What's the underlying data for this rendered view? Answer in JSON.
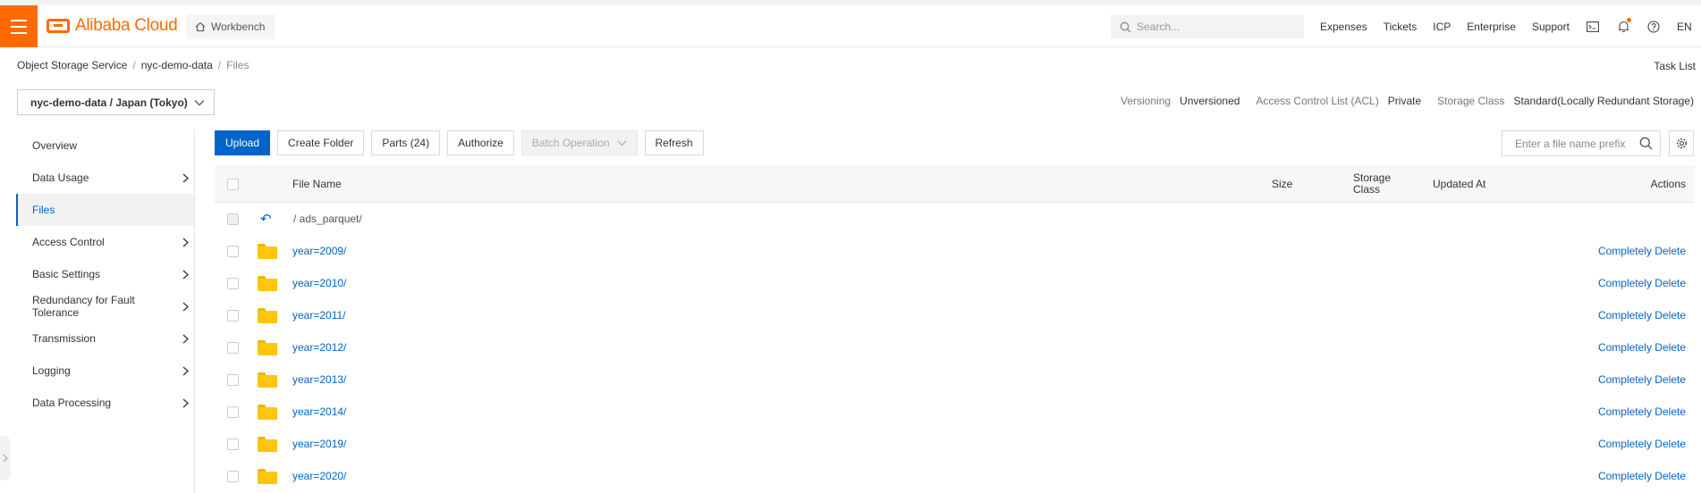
{
  "header": {
    "logo_text": "Alibaba Cloud",
    "workbench_label": "Workbench",
    "search_placeholder": "Search...",
    "links": [
      "Expenses",
      "Tickets",
      "ICP",
      "Enterprise",
      "Support"
    ],
    "lang": "EN",
    "accent": "#ff6a00"
  },
  "breadcrumb": [
    "Object Storage Service",
    "nyc-demo-data",
    "Files"
  ],
  "task_list": "Task List",
  "bucket": {
    "selected": "nyc-demo-data / Japan (Tokyo)",
    "meta": [
      {
        "key": "Versioning",
        "value": "Unversioned"
      },
      {
        "key": "Access Control List (ACL)",
        "value": "Private"
      },
      {
        "key": "Storage Class",
        "value": "Standard(Locally Redundant Storage)"
      }
    ]
  },
  "sidebar": {
    "items": [
      {
        "label": "Overview",
        "chevron": false,
        "active": false
      },
      {
        "label": "Data Usage",
        "chevron": true,
        "active": false
      },
      {
        "label": "Files",
        "chevron": false,
        "active": true
      },
      {
        "label": "Access Control",
        "chevron": true,
        "active": false
      },
      {
        "label": "Basic Settings",
        "chevron": true,
        "active": false
      },
      {
        "label": "Redundancy for Fault Tolerance",
        "chevron": true,
        "active": false
      },
      {
        "label": "Transmission",
        "chevron": true,
        "active": false
      },
      {
        "label": "Logging",
        "chevron": true,
        "active": false
      },
      {
        "label": "Data Processing",
        "chevron": true,
        "active": false
      }
    ]
  },
  "toolbar": {
    "upload": "Upload",
    "create_folder": "Create Folder",
    "parts": "Parts (24)",
    "authorize": "Authorize",
    "batch_operation": "Batch Operation",
    "refresh": "Refresh",
    "prefix_placeholder": "Enter a file name prefix"
  },
  "table": {
    "columns": {
      "file_name": "File Name",
      "size": "Size",
      "storage_class": "Storage Class",
      "updated_at": "Updated At",
      "actions": "Actions"
    },
    "parent_path": "/ ads_parquet/",
    "rows": [
      {
        "name": "year=2009/",
        "action": "Completely Delete"
      },
      {
        "name": "year=2010/",
        "action": "Completely Delete"
      },
      {
        "name": "year=2011/",
        "action": "Completely Delete"
      },
      {
        "name": "year=2012/",
        "action": "Completely Delete"
      },
      {
        "name": "year=2013/",
        "action": "Completely Delete"
      },
      {
        "name": "year=2014/",
        "action": "Completely Delete"
      },
      {
        "name": "year=2019/",
        "action": "Completely Delete"
      },
      {
        "name": "year=2020/",
        "action": "Completely Delete"
      }
    ]
  }
}
